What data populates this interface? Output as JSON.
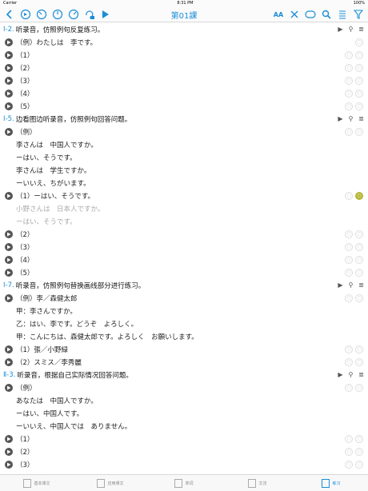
{
  "status": {
    "carrier": "Carrier",
    "time": "8:31 PM",
    "battery": "100%"
  },
  "toolbar": {
    "title": "第01課",
    "font_label": "AA"
  },
  "sections": [
    {
      "num": "Ⅰ-2.",
      "title": "听录音，仿照例句反复练习。",
      "rows": [
        {
          "type": "play",
          "text": "（例）わたしは　李です。"
        },
        {
          "type": "play",
          "text": "（1）"
        },
        {
          "type": "play",
          "text": "（2）"
        },
        {
          "type": "play",
          "text": "（3）"
        },
        {
          "type": "play",
          "text": "（4）"
        },
        {
          "type": "play",
          "text": "（5）"
        }
      ]
    },
    {
      "num": "Ⅰ-5.",
      "title": "边看图边听录音，仿照例句回答问题。",
      "rows": [
        {
          "type": "play",
          "text": "（例）"
        },
        {
          "type": "sub",
          "text": "李さんは　中国人ですか。"
        },
        {
          "type": "sub",
          "text": "ーはい、そうです。"
        },
        {
          "type": "sub",
          "text": "李さんは　学生ですか。"
        },
        {
          "type": "sub",
          "text": "ーいいえ、ちがいます。"
        },
        {
          "type": "play",
          "text": "（1）ーはい、そうです。"
        },
        {
          "type": "subgray",
          "text": "小野さんは　日本人ですか。"
        },
        {
          "type": "subgray",
          "text": "ーはい、そうです。"
        },
        {
          "type": "play",
          "text": "（2）"
        },
        {
          "type": "play",
          "text": "（3）"
        },
        {
          "type": "play",
          "text": "（4）"
        },
        {
          "type": "play",
          "text": "（5）"
        }
      ]
    },
    {
      "num": "Ⅰ-7.",
      "title": "听录音，仿照例句替换画线部分进行练习。",
      "rows": [
        {
          "type": "play",
          "text": "（例）李／森健太郎"
        },
        {
          "type": "sub",
          "text": "甲：李さんですか。"
        },
        {
          "type": "sub",
          "text": "乙：はい、李です。どうぞ　よろしく。"
        },
        {
          "type": "sub",
          "text": "甲：こんにちは、森健太郎です。よろしく　お願いします。"
        },
        {
          "type": "play",
          "text": "（1）張／小野緑"
        },
        {
          "type": "play",
          "text": "（2）スミス／李秀麗"
        }
      ]
    },
    {
      "num": "Ⅱ-3.",
      "title": "听录音，根据自己实际情况回答问题。",
      "rows": [
        {
          "type": "play",
          "text": "（例）"
        },
        {
          "type": "sub",
          "text": "あなたは　中国人ですか。"
        },
        {
          "type": "sub",
          "text": "ーはい、中国人です。"
        },
        {
          "type": "sub",
          "text": "ーいいえ、中国人では　ありません。"
        },
        {
          "type": "play",
          "text": "（1）"
        },
        {
          "type": "play",
          "text": "（2）"
        },
        {
          "type": "play",
          "text": "（3）"
        }
      ]
    }
  ],
  "tabs": [
    {
      "label": "基本课文"
    },
    {
      "label": "应用课文"
    },
    {
      "label": "单词"
    },
    {
      "label": "文法"
    },
    {
      "label": "练习"
    }
  ],
  "colors": {
    "accent": "#1a8ed8",
    "correct": "#3ab34a",
    "alt": "#b6b637"
  }
}
